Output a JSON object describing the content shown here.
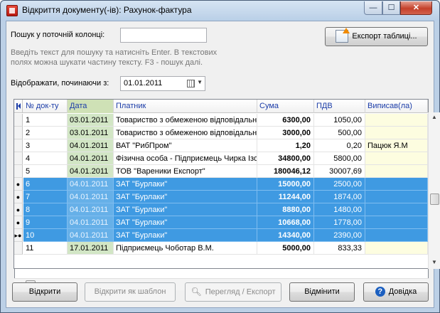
{
  "window": {
    "title": "Відкриття документу(-ів): Рахунок-фактура",
    "min_glyph": "—",
    "max_glyph": "☐",
    "close_glyph": "✕"
  },
  "search": {
    "label": "Пошук у поточній колонці:",
    "value": "",
    "hint_line1": "Введіть текст для пошуку та натисніть Enter. В текстових",
    "hint_line2": "полях можна шукати частину тексту. F3 - пошук далі."
  },
  "export_table_button": "Експорт таблиці...",
  "date_filter": {
    "label": "Відображати, починаючи з:",
    "value": "01.01.2011"
  },
  "grid": {
    "columns": [
      "№ док-ту",
      "Дата",
      "Платник",
      "Сума",
      "ПДВ",
      "Виписав(ла)"
    ],
    "rows": [
      {
        "marker": "",
        "num": "1",
        "date": "03.01.2011",
        "payer": "Товариство з обмеженою відповідальн",
        "sum": "6300,00",
        "vat": "1050,00",
        "signed": "",
        "selected": false
      },
      {
        "marker": "",
        "num": "2",
        "date": "03.01.2011",
        "payer": "Товариство з обмеженою відповідальн",
        "sum": "3000,00",
        "vat": "500,00",
        "signed": "",
        "selected": false
      },
      {
        "marker": "",
        "num": "3",
        "date": "04.01.2011",
        "payer": "ВАТ \"РибПром\"",
        "sum": "1,20",
        "vat": "0,20",
        "signed": "Пацюк Я.М",
        "selected": false
      },
      {
        "marker": "",
        "num": "4",
        "date": "04.01.2011",
        "payer": "Фізична особа - Підприємець Чирка Ізол",
        "sum": "34800,00",
        "vat": "5800,00",
        "signed": "",
        "selected": false
      },
      {
        "marker": "",
        "num": "5",
        "date": "04.01.2011",
        "payer": "ТОВ \"Вареники Експорт\"",
        "sum": "180046,12",
        "vat": "30007,69",
        "signed": "",
        "selected": false
      },
      {
        "marker": "●",
        "num": "6",
        "date": "04.01.2011",
        "payer": "ЗАТ \"Бурлаки\"",
        "sum": "15000,00",
        "vat": "2500,00",
        "signed": "",
        "selected": true
      },
      {
        "marker": "●",
        "num": "7",
        "date": "04.01.2011",
        "payer": "ЗАТ \"Бурлаки\"",
        "sum": "11244,00",
        "vat": "1874,00",
        "signed": "",
        "selected": true
      },
      {
        "marker": "●",
        "num": "8",
        "date": "04.01.2011",
        "payer": "ЗАТ \"Бурлаки\"",
        "sum": "8880,00",
        "vat": "1480,00",
        "signed": "",
        "selected": true
      },
      {
        "marker": "●",
        "num": "9",
        "date": "04.01.2011",
        "payer": "ЗАТ \"Бурлаки\"",
        "sum": "10668,00",
        "vat": "1778,00",
        "signed": "",
        "selected": true
      },
      {
        "marker": "▸●",
        "num": "10",
        "date": "04.01.2011",
        "payer": "ЗАТ \"Бурлаки\"",
        "sum": "14340,00",
        "vat": "2390,00",
        "signed": "",
        "selected": true
      },
      {
        "marker": "",
        "num": "11",
        "date": "17.01.2011",
        "payer": "Підприємець Чоботар В.М.",
        "sum": "5000,00",
        "vat": "833,33",
        "signed": "",
        "selected": false
      }
    ]
  },
  "buttons": {
    "open": "Відкрити",
    "open_as_template": "Відкрити як шаблон",
    "preview_export": "Перегляд / Експорт",
    "cancel": "Відмінити",
    "help": "Довідка"
  },
  "colors": {
    "selection": "#3f9ae2",
    "date_column": "#d2e6c5",
    "signed_column": "#fdfde0",
    "header_text": "#1b3ca8"
  }
}
